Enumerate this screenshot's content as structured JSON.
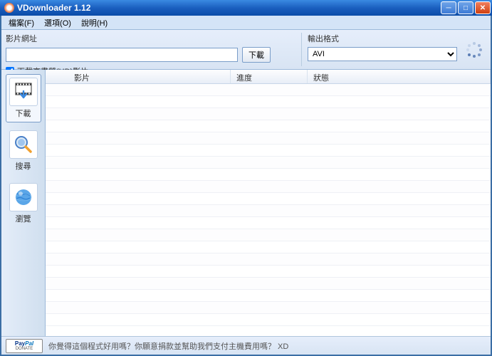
{
  "window": {
    "title": "VDownloader 1.12"
  },
  "menu": {
    "file": "檔案(F)",
    "options": "選項(O)",
    "help": "說明(H)"
  },
  "toolbar": {
    "url_label": "影片網址",
    "download_btn": "下載",
    "hd_checkbox": "下載高畫質(HD)影片",
    "format_label": "輸出格式",
    "format_value": "AVI"
  },
  "sidebar": {
    "download": "下載",
    "search": "搜尋",
    "browse": "瀏覽"
  },
  "columns": {
    "video": "影片",
    "progress": "進度",
    "status": "狀態"
  },
  "status": {
    "msg": "你覺得這個程式好用嗎？你願意捐款並幫助我們支付主機費用嗎？ XD",
    "paypal_main": "PayPal",
    "paypal_sub": "DONATE"
  }
}
